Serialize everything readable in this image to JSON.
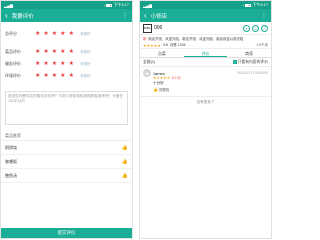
{
  "left": {
    "status_time": "下午3:17",
    "title": "我要评价",
    "ratings": [
      {
        "label": "总评分",
        "stars": 5,
        "hint": "非常好"
      },
      {
        "label": "菜品评价",
        "stars": 5,
        "hint": "非常好"
      },
      {
        "label": "服务评价",
        "stars": 5,
        "hint": "非常好"
      },
      {
        "label": "环境评价",
        "stars": 5,
        "hint": "非常好"
      }
    ],
    "comment_placeholder": "说说您对餐饮店的服务评价吧？与您心得体验和其他顾客参考吧！长度在100字以内",
    "dishes_label": "菜品推荐",
    "dishes": [
      {
        "name": "铜锣烧",
        "liked": true
      },
      {
        "name": "咖喱饭",
        "liked": false
      },
      {
        "name": "鲍鱼汤",
        "liked": false
      }
    ],
    "submit_label": "提交评价"
  },
  "right": {
    "status_time": "下午3:17",
    "title": "小饰店",
    "logo_text": "KFC",
    "shop_name": "006",
    "notice_badge": "新",
    "notice_text": "新店开张，欢迎光临，新店开张，欢迎光临，新店欢迎以前光临",
    "rating_text": "4.8",
    "sales_text": "月售 1234",
    "distance": "1.5千米",
    "tabs": [
      "点菜",
      "评价",
      "商家"
    ],
    "active_tab": 1,
    "filter_label": "全部(1)",
    "filter_check_label": "只看有内容的评价",
    "review": {
      "name": "James",
      "date": "2016-10-17 00:00:00",
      "stars": 5,
      "score": "5.0 分",
      "text": "十分好",
      "dish": "铜锣烧"
    },
    "no_more": "没有更多了"
  },
  "colors": {
    "primary": "#1aae97",
    "statusbar": "#16a089",
    "star_red": "#e8403b",
    "star_orange": "#f5a623"
  }
}
